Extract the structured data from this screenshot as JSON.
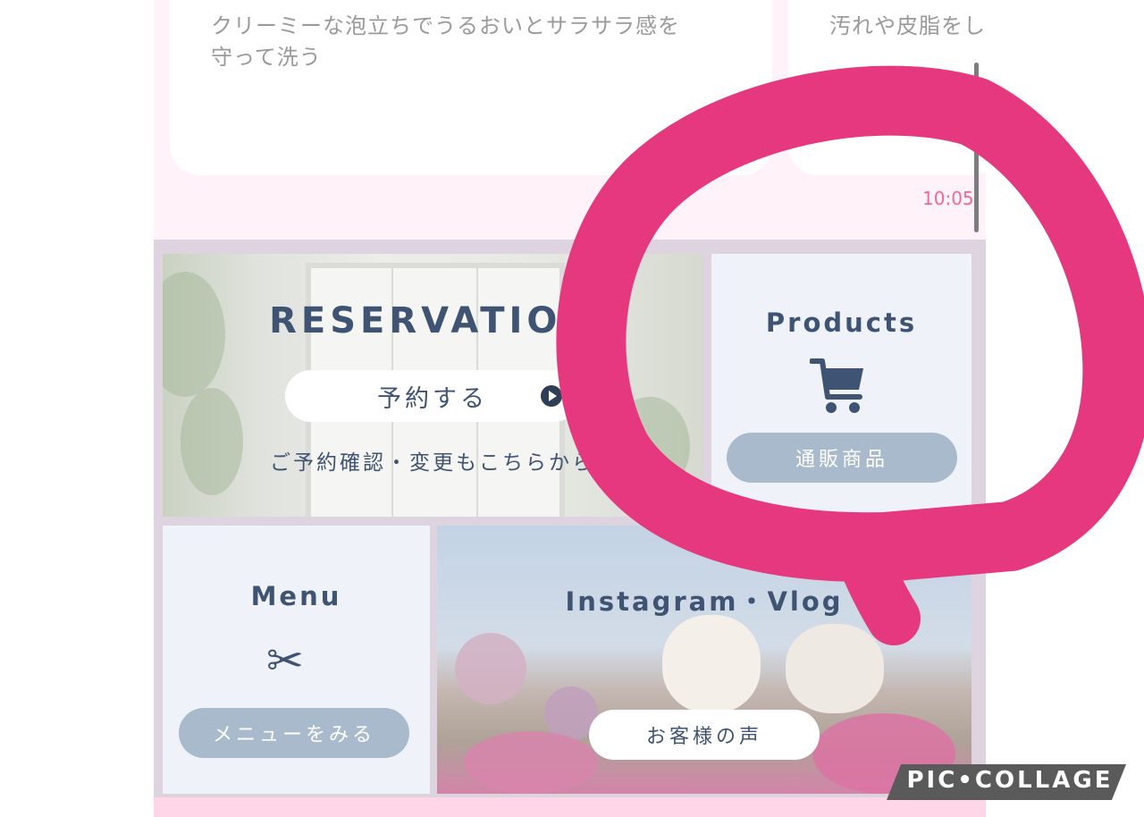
{
  "cards": [
    {
      "text": "クリーミーな泡立ちでうるおいとサラサラ感を\n守って洗う"
    },
    {
      "text": "汚れや皮脂をし\n洗いあがりは最"
    }
  ],
  "chat": {
    "time": "10:05"
  },
  "reservation": {
    "title": "RESERVATION",
    "button_label": "予約する",
    "subtext": "ご予約確認・変更もこちらから"
  },
  "products": {
    "title": "Products",
    "icon": "cart-icon",
    "button_label": "通販商品"
  },
  "menu": {
    "title": "Menu",
    "icon": "scissors-icon",
    "icon_glyph": "✂",
    "button_label": "メニューをみる"
  },
  "instagram": {
    "title": "Instagram・Vlog",
    "button_label": "お客様の声"
  },
  "watermark": {
    "text": "PIC•COLLAGE"
  },
  "colors": {
    "accent_text": "#3f5373",
    "pill_blue": "#a8bacb",
    "annotation_pink": "#e5387f",
    "time_pink": "#f0679a"
  }
}
